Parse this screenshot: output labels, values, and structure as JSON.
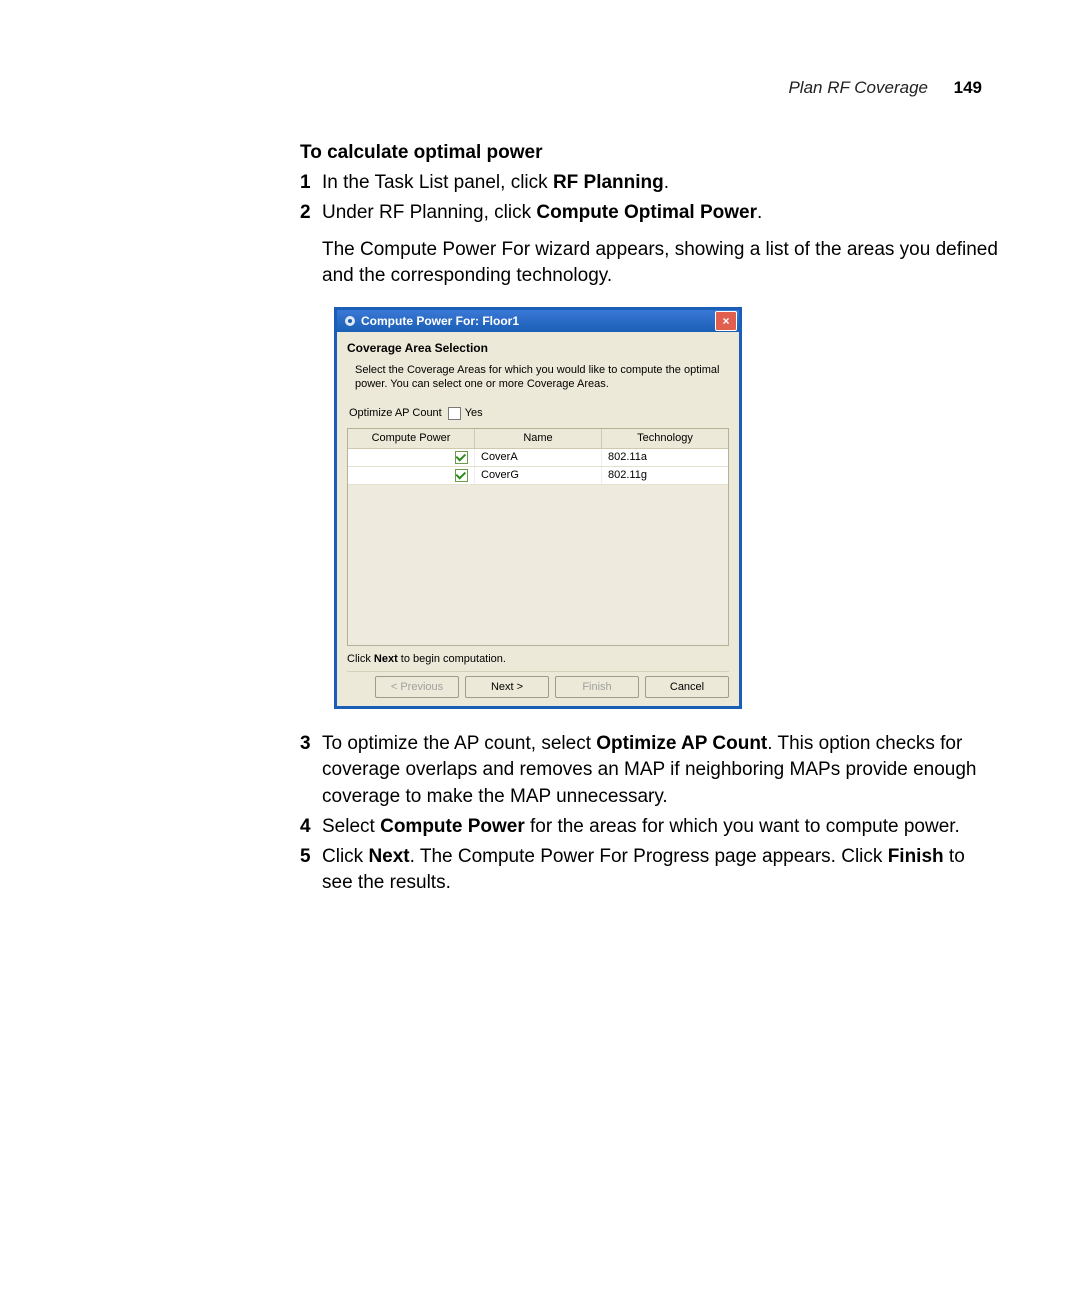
{
  "header": {
    "section": "Plan RF Coverage",
    "page": "149"
  },
  "heading": "To calculate optimal power",
  "steps": {
    "s1": {
      "num": "1",
      "pre": "In the Task List panel, click ",
      "bold": "RF Planning",
      "post": "."
    },
    "s2": {
      "num": "2",
      "pre": "Under RF Planning, click ",
      "bold": "Compute Optimal Power",
      "post": "."
    },
    "s2p": "The Compute Power For wizard appears, showing a list of the areas you defined and the corresponding technology.",
    "s3": {
      "num": "3",
      "pre": "To optimize the AP count, select ",
      "bold": "Optimize AP Count",
      "post": ". This option checks for coverage overlaps and removes an MAP if neighboring MAPs provide enough coverage to make the MAP unnecessary."
    },
    "s4": {
      "num": "4",
      "pre": "Select ",
      "bold": "Compute Power",
      "post": " for the areas for which you want to compute power."
    },
    "s5": {
      "num": "5",
      "pre": "Click ",
      "bold": "Next",
      "mid": ". The Compute Power For Progress page appears. Click ",
      "bold2": "Finish",
      "post": " to see the results."
    }
  },
  "dialog": {
    "title": "Compute Power For: Floor1",
    "section": "Coverage Area Selection",
    "desc": "Select the Coverage Areas for which you would like to compute the optimal power. You can select one or more Coverage Areas.",
    "opt_label": "Optimize AP Count",
    "opt_value": "Yes",
    "columns": {
      "c1": "Compute Power",
      "c2": "Name",
      "c3": "Technology"
    },
    "rows": [
      {
        "name": "CoverA",
        "tech": "802.11a"
      },
      {
        "name": "CoverG",
        "tech": "802.11g"
      }
    ],
    "hint_pre": "Click ",
    "hint_bold": "Next",
    "hint_post": " to begin computation.",
    "buttons": {
      "prev": "< Previous",
      "next": "Next >",
      "finish": "Finish",
      "cancel": "Cancel"
    }
  }
}
